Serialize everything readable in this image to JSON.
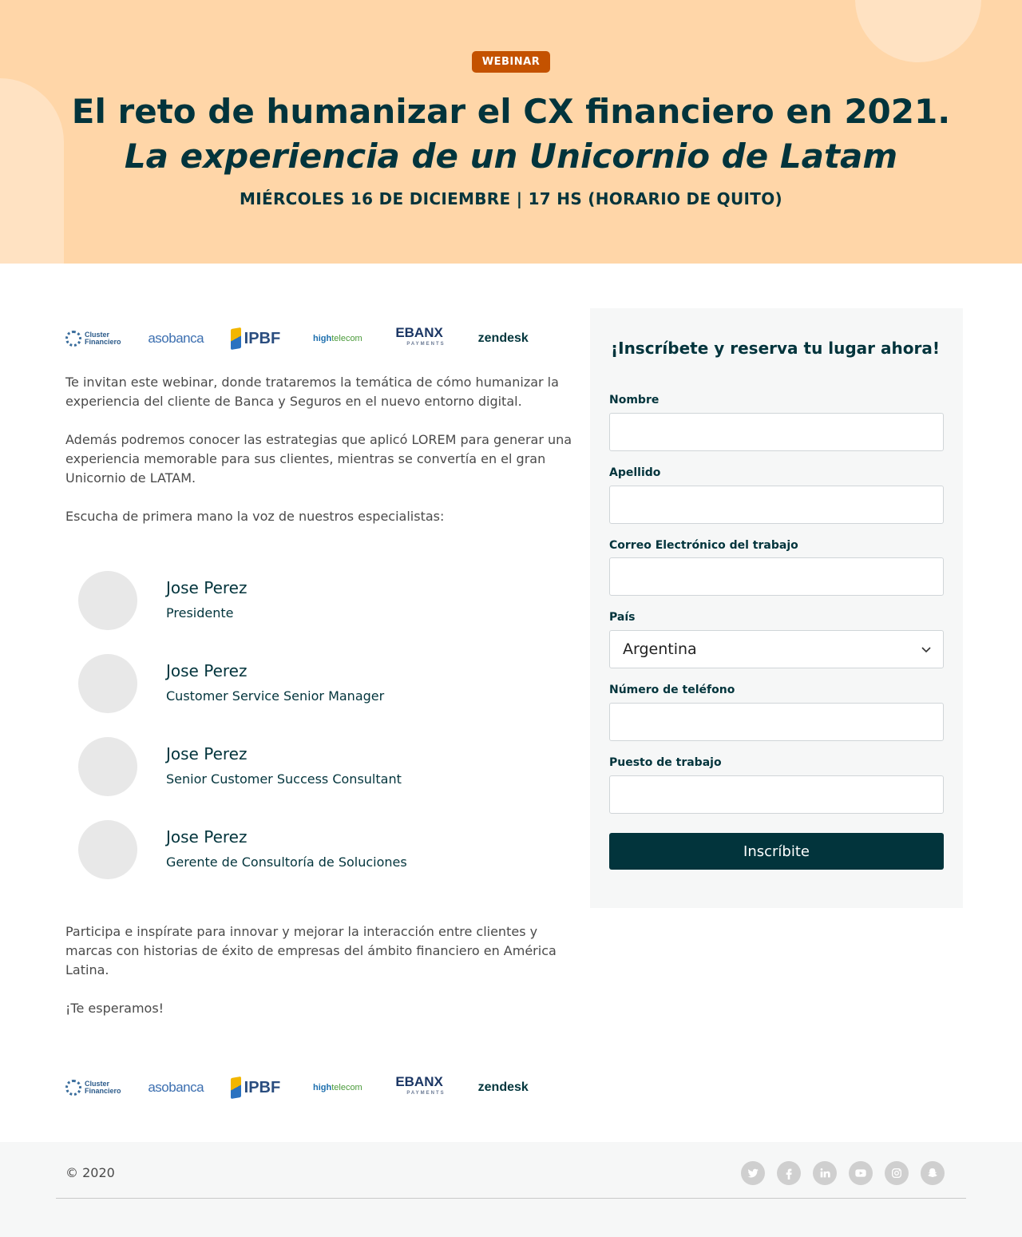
{
  "hero": {
    "badge": "WEBINAR",
    "title": "El reto de humanizar el CX financiero en 2021.",
    "subtitle": "La experiencia de un Unicornio de Latam",
    "date": "MIÉRCOLES 16 DE DICIEMBRE | 17 HS (HORARIO DE QUITO)",
    "bg_color": "#ffd6a8",
    "badge_color": "#c45200"
  },
  "logos": {
    "cluster_line1": "Cluster",
    "cluster_line2": "Financiero",
    "asobanca": "asobanca",
    "ipbf": "IPBF",
    "hightelecom_a": "high",
    "hightelecom_b": "telecom",
    "ebanx": "EBANX",
    "ebanx_sub": "PAYMENTS",
    "zendesk": "zendesk"
  },
  "content": {
    "intro": "Te invitan este webinar, donde trataremos la temática de cómo humanizar la experiencia del cliente de Banca y Seguros en el nuevo entorno digital.",
    "strategy": "Además podremos conocer las estrategias que aplicó LOREM para generar una experiencia memorable para sus clientes, mientras se convertía en el gran Unicornio de LATAM.",
    "listen": "Escucha de primera mano la voz de nuestros especialistas:",
    "participate": "Participa e inspírate para innovar y mejorar la interacción entre clientes y marcas con historias de éxito de empresas del ámbito financiero en América Latina.",
    "closing": "¡Te esperamos!"
  },
  "speakers": [
    {
      "name": "Jose Perez",
      "role": "Presidente"
    },
    {
      "name": "Jose Perez",
      "role": "Customer Service Senior Manager"
    },
    {
      "name": "Jose Perez",
      "role": "Senior Customer Success Consultant"
    },
    {
      "name": "Jose Perez",
      "role": "Gerente de Consultoría de Soluciones"
    }
  ],
  "form": {
    "title": "¡Inscríbete y reserva tu lugar ahora!",
    "first_name_label": "Nombre",
    "first_name_value": "",
    "last_name_label": "Apellido",
    "last_name_value": "",
    "email_label": "Correo Electrónico del trabajo",
    "email_value": "",
    "country_label": "País",
    "country_value": "Argentina",
    "phone_label": "Número de teléfono",
    "phone_value": "",
    "job_label": "Puesto de trabajo",
    "job_value": "",
    "submit_label": "Inscríbite",
    "primary_color": "#02343c"
  },
  "footer": {
    "copyright": "© 2020",
    "social_icons": [
      "twitter-icon",
      "facebook-icon",
      "linkedin-icon",
      "youtube-icon",
      "instagram-icon",
      "snapchat-icon"
    ]
  }
}
